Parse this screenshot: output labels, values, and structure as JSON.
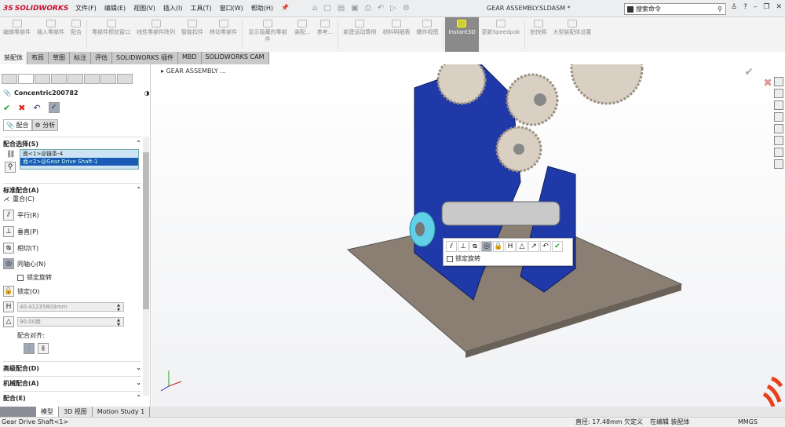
{
  "app": {
    "logo": "SOLIDWORKS",
    "document_title": "GEAR ASSEMBLY.SLDASM *"
  },
  "menu": [
    "文件(F)",
    "编辑(E)",
    "视图(V)",
    "插入(I)",
    "工具(T)",
    "窗口(W)",
    "帮助(H)"
  ],
  "search": {
    "placeholder": "搜索命令"
  },
  "ribbon": [
    "编辑零部件",
    "插入零部件",
    "配合",
    "零部件预览窗口",
    "线性零部件阵列",
    "智能扣件",
    "移动零部件",
    "显示隐藏的零部件",
    "装配...",
    "参考...",
    "新建运动算例",
    "材料明细表",
    "爆炸视图",
    "Instant3D",
    "更新Speedpak",
    "拍快照",
    "大型装配体设置"
  ],
  "tabs": [
    "装配体",
    "布局",
    "草图",
    "标注",
    "评估",
    "SOLIDWORKS 插件",
    "MBD",
    "SOLIDWORKS CAM"
  ],
  "panel": {
    "title": "Concentric200782",
    "subtabs": [
      "配合",
      "分析"
    ],
    "selection_header": "配合选择(S)",
    "selections": [
      "面<1>@链条-4",
      "面<2>@Gear Drive Shaft-1"
    ],
    "standard_header": "标准配合(A)",
    "mates": [
      "重合(C)",
      "平行(R)",
      "垂直(P)",
      "相切(T)",
      "同轴心(N)"
    ],
    "lock_rotation": "锁定旋转",
    "lock_mate": "锁定(O)",
    "distance": "40.41235803mm",
    "angle": "90.00度",
    "alignment_label": "配合对齐:",
    "advanced_header": "高级配合(D)",
    "mechanical_header": "机械配合(A)",
    "mates_header": "配合(E)"
  },
  "viewport": {
    "breadcrumb": "GEAR ASSEMBLY ...",
    "popup_lock": "锁定旋转"
  },
  "bottom_tabs": [
    "模型",
    "3D 视图",
    "Motion Study 1"
  ],
  "status": {
    "left": "Gear Drive Shaft<1>",
    "measure": "直径: 17.48mm",
    "state": "欠定义",
    "mode": "在编辑 装配体",
    "units": "MMGS"
  }
}
